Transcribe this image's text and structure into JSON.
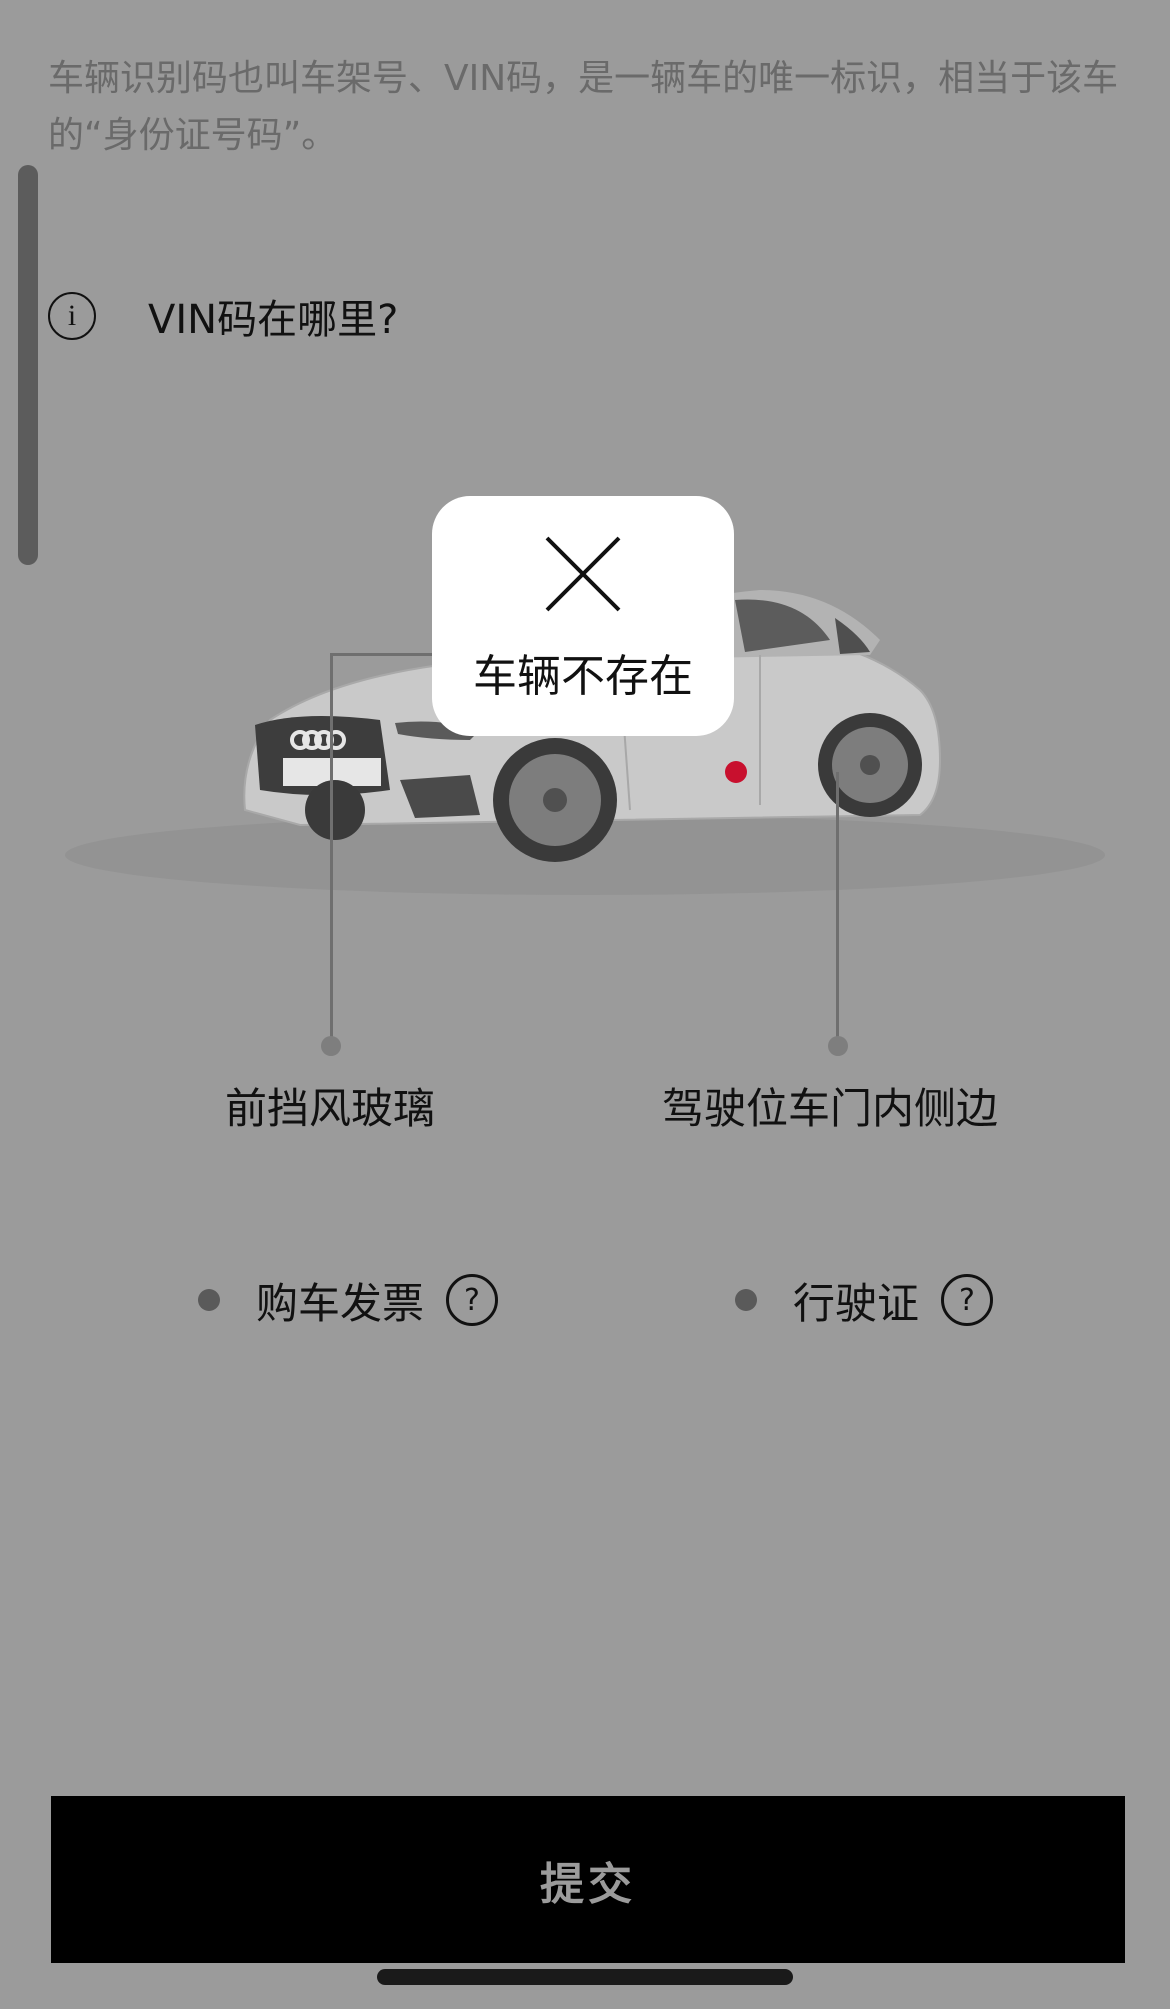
{
  "intro": {
    "text": "车辆识别码也叫车架号、VIN码，是一辆车的唯一标识，相当于该车的“身份证号码”。"
  },
  "info": {
    "icon": "info-icon",
    "icon_glyph": "i",
    "title": "VIN码在哪里?"
  },
  "car_image": {
    "description_icon": "car-illustration",
    "highlight_color": "#c8102e"
  },
  "locations": {
    "left_label": "前挡风玻璃",
    "right_label": "驾驶位车门内侧边"
  },
  "documents": {
    "items": [
      {
        "label": "购车发票",
        "help_glyph": "?"
      },
      {
        "label": "行驶证",
        "help_glyph": "?"
      }
    ]
  },
  "footer": {
    "submit_label": "提交"
  },
  "toast": {
    "icon": "close-icon",
    "message": "车辆不存在"
  },
  "colors": {
    "overlay_background": "#9b9b9b",
    "button_background": "#000000",
    "button_text": "#9b9b9b",
    "toast_background": "#ffffff"
  }
}
